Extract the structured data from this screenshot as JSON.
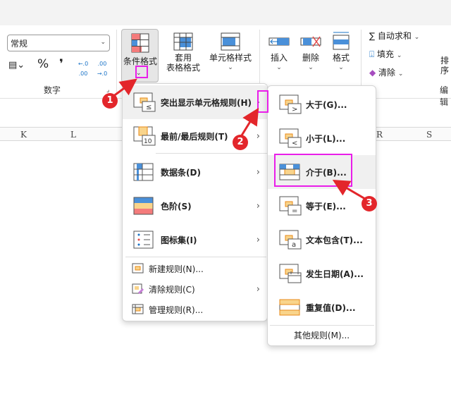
{
  "ribbon": {
    "number_format": "常规",
    "percent": "%",
    "comma": "❜",
    "increase_decimal": "←.0 .00",
    "decrease_decimal": ".00 →.0",
    "number_group": "数字",
    "conditional_formatting": "条件格式",
    "format_as_table_1": "套用",
    "format_as_table_2": "表格格式",
    "cell_styles": "单元格样式",
    "insert": "插入",
    "delete": "删除",
    "format": "格式",
    "autosum": "自动求和",
    "fill": "填充",
    "clear": "清除",
    "sort": "排序",
    "editing_group": "编辑"
  },
  "columns": [
    "K",
    "L",
    "R",
    "S"
  ],
  "menu": {
    "items": [
      {
        "label": "突出显示单元格规则(H)"
      },
      {
        "label": "最前/最后规则(T)"
      },
      {
        "label": "数据条(D)"
      },
      {
        "label": "色阶(S)"
      },
      {
        "label": "图标集(I)"
      },
      {
        "label": "新建规则(N)..."
      },
      {
        "label": "清除规则(C)"
      },
      {
        "label": "管理规则(R)..."
      }
    ]
  },
  "submenu": {
    "items": [
      {
        "label": "大于(G)..."
      },
      {
        "label": "小于(L)..."
      },
      {
        "label": "介于(B)..."
      },
      {
        "label": "等于(E)..."
      },
      {
        "label": "文本包含(T)..."
      },
      {
        "label": "发生日期(A)..."
      },
      {
        "label": "重复值(D)..."
      }
    ],
    "more": "其他规则(M)..."
  },
  "annotations": [
    "1",
    "2",
    "3"
  ],
  "colors": {
    "highlight": "#e91ee9",
    "marker": "#e3262b"
  }
}
